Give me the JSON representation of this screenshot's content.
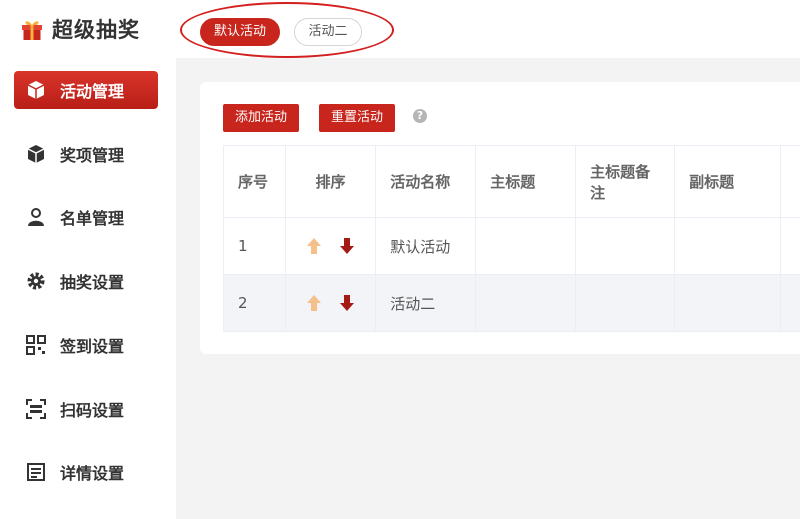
{
  "app": {
    "title": "超级抽奖"
  },
  "activity_tabs": [
    {
      "label": "默认活动",
      "active": true
    },
    {
      "label": "活动二",
      "active": false
    }
  ],
  "sidebar": {
    "items": [
      {
        "label": "活动管理",
        "icon": "cube-icon",
        "active": true
      },
      {
        "label": "奖项管理",
        "icon": "prize-box-icon",
        "active": false
      },
      {
        "label": "名单管理",
        "icon": "user-icon",
        "active": false
      },
      {
        "label": "抽奖设置",
        "icon": "gear-icon",
        "active": false
      },
      {
        "label": "签到设置",
        "icon": "qrcode-icon",
        "active": false
      },
      {
        "label": "扫码设置",
        "icon": "scan-icon",
        "active": false
      },
      {
        "label": "详情设置",
        "icon": "detail-icon",
        "active": false
      }
    ]
  },
  "toolbar": {
    "add_label": "添加活动",
    "reset_label": "重置活动",
    "help_text": "?"
  },
  "table": {
    "columns": [
      "序号",
      "排序",
      "活动名称",
      "主标题",
      "主标题备注",
      "副标题"
    ],
    "rows": [
      {
        "seq": "1",
        "name": "默认活动"
      },
      {
        "seq": "2",
        "name": "活动二"
      }
    ]
  },
  "colors": {
    "brand_red": "#c8251d",
    "up_arrow": "#f5c08a",
    "down_arrow": "#a51a14"
  }
}
